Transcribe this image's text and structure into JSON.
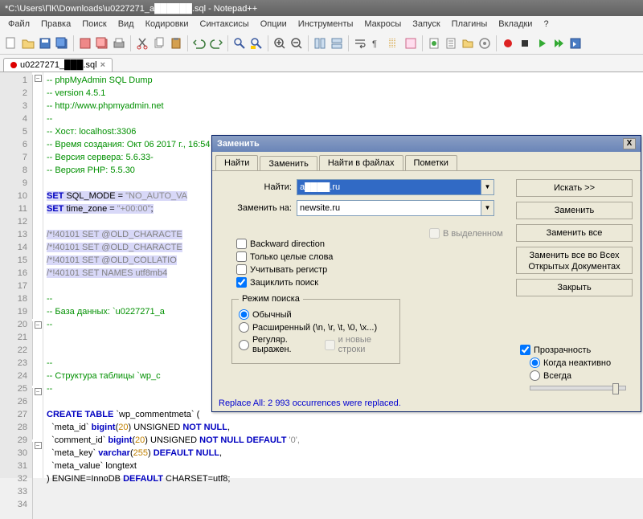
{
  "window": {
    "title": "*C:\\Users\\ПК\\Downloads\\u0227271_a██████.sql - Notepad++"
  },
  "menu": [
    "Файл",
    "Правка",
    "Поиск",
    "Вид",
    "Кодировки",
    "Синтаксисы",
    "Опции",
    "Инструменты",
    "Макросы",
    "Запуск",
    "Плагины",
    "Вкладки",
    "?"
  ],
  "tab": {
    "name": "u0227271_███.sql",
    "close": "×"
  },
  "lines": [
    "1",
    "2",
    "3",
    "4",
    "5",
    "6",
    "7",
    "8",
    "9",
    "10",
    "11",
    "12",
    "13",
    "14",
    "15",
    "16",
    "17",
    "18",
    "19",
    "20",
    "21",
    "22",
    "23",
    "24",
    "25",
    "26",
    "27",
    "28",
    "29",
    "30",
    "31",
    "32",
    "33",
    "34"
  ],
  "code": {
    "l1": "-- phpMyAdmin SQL Dump",
    "l2": "-- version 4.5.1",
    "l3": "-- http://www.phpmyadmin.net",
    "l4": "--",
    "l5": "-- Хост: localhost:3306",
    "l6": "-- Время создания: Окт 06 2017 г., 16:54",
    "l7": "-- Версия сервера: 5.6.33-",
    "l8": "-- Версия PHP: 5.5.30",
    "l10a": "SET",
    "l10b": " SQL_MODE = ",
    "l10c": "\"NO_AUTO_VA",
    "l11a": "SET",
    "l11b": " time_zone = ",
    "l11c": "\"+00:00\"",
    "l11d": ";",
    "l14": "/*!40101 SET @OLD_CHARACTE",
    "l15": "/*!40101 SET @OLD_CHARACTE",
    "l16": "/*!40101 SET @OLD_COLLATIO",
    "l17": "/*!40101 SET NAMES utf8mb4",
    "l19": "--",
    "l21a": "-- База данных: `u0227271_a",
    "l22": "--",
    "l25": "--",
    "l26": "-- Структура таблицы `wp_c",
    "l27": "--",
    "l29a": "CREATE TABLE",
    "l29b": " `wp_commentmeta` (",
    "l30a": "  `meta_id` ",
    "l30b": "bigint",
    "l30c": "(",
    "l30d": "20",
    "l30e": ") UNSIGNED ",
    "l30f": "NOT NULL",
    "l30g": ",",
    "l31a": "  `comment_id` ",
    "l31b": "bigint",
    "l31c": "(",
    "l31d": "20",
    "l31e": ") UNSIGNED ",
    "l31f": "NOT NULL DEFAULT",
    "l31g": " '0',",
    "l32a": "  `meta_key` ",
    "l32b": "varchar",
    "l32c": "(",
    "l32d": "255",
    "l32e": ") ",
    "l32f": "DEFAULT NULL",
    "l32g": ",",
    "l33": "  `meta_value` longtext",
    "l34a": ") ENGINE=InnoDB ",
    "l34b": "DEFAULT",
    "l34c": " CHARSET=utf8;"
  },
  "dlg": {
    "title": "Заменить",
    "close": "X",
    "tabs": [
      "Найти",
      "Заменить",
      "Найти в файлах",
      "Пометки"
    ],
    "active_tab": 1,
    "find_label": "Найти:",
    "find_value": "a████.ru",
    "replace_label": "Заменить на:",
    "replace_value": "newsite.ru",
    "in_selection": "В выделенном",
    "opts": {
      "backward": "Backward direction",
      "whole": "Только целые слова",
      "case": "Учитывать регистр",
      "wrap": "Зациклить поиск"
    },
    "mode_legend": "Режим поиска",
    "modes": {
      "normal": "Обычный",
      "ext": "Расширенный (\\n, \\r, \\t, \\0, \\x...)",
      "regex": "Регуляр. выражен.",
      "regex_nl": "и новые строки"
    },
    "btns": {
      "search": "Искать >>",
      "replace": "Заменить",
      "replace_all": "Заменить все",
      "replace_open": "Заменить все во Всех Открытых Документах",
      "close": "Закрыть"
    },
    "trans": {
      "label": "Прозрачность",
      "inactive": "Когда неактивно",
      "always": "Всегда"
    },
    "status": "Replace All: 2 993 occurrences were replaced."
  }
}
